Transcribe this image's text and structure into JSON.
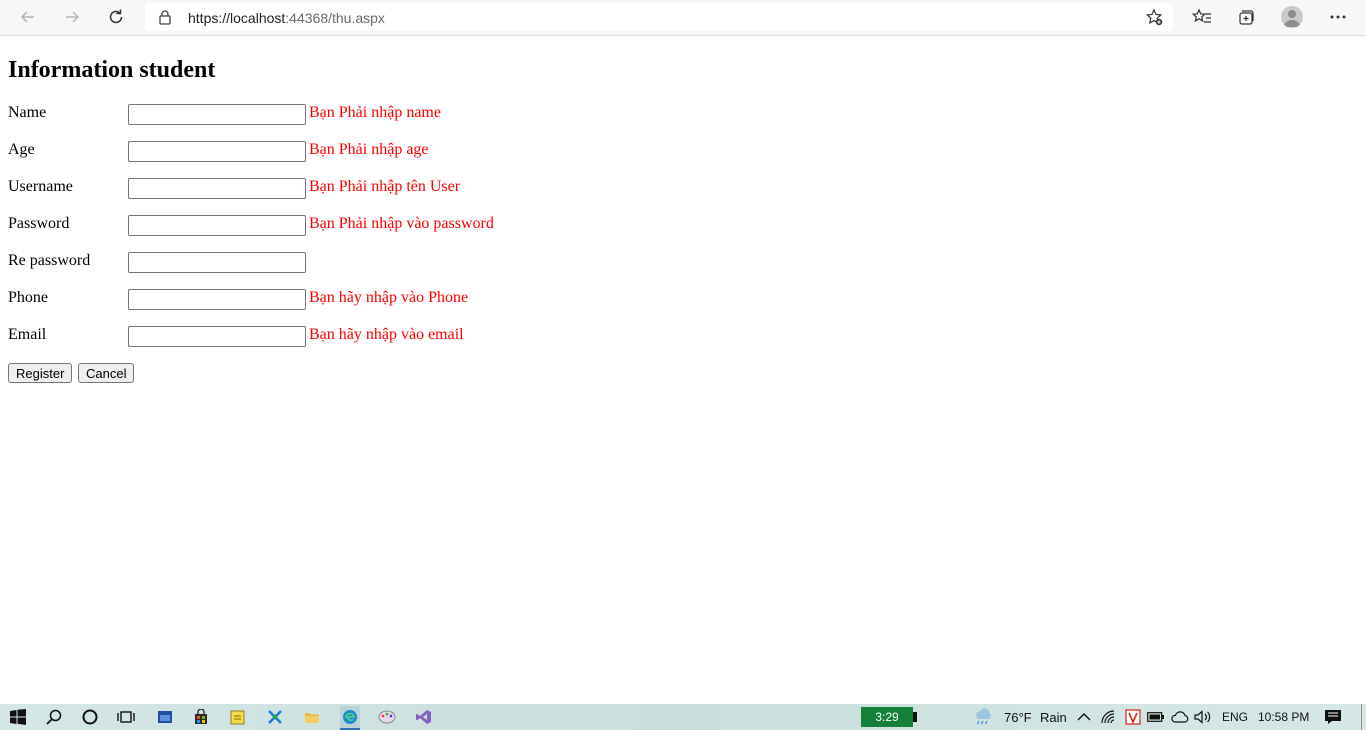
{
  "browser": {
    "url_host": "https://localhost",
    "url_rest": ":44368/thu.aspx"
  },
  "page": {
    "title": "Information student",
    "fields": [
      {
        "label": "Name",
        "value": "",
        "error": "Bạn Phải nhập name"
      },
      {
        "label": "Age",
        "value": "",
        "error": "Bạn Phải nhập age"
      },
      {
        "label": "Username",
        "value": "",
        "error": "Bạn Phải nhập tên User"
      },
      {
        "label": "Password",
        "value": "",
        "error": "Bạn Phải nhập vào password"
      },
      {
        "label": "Re password",
        "value": "",
        "error": ""
      },
      {
        "label": "Phone",
        "value": "",
        "error": "Bạn hãy nhập vào Phone"
      },
      {
        "label": "Email",
        "value": "",
        "error": "Bạn hãy nhập vào email"
      }
    ],
    "register_label": "Register",
    "cancel_label": "Cancel"
  },
  "taskbar": {
    "battery_time": "3:29",
    "weather_temp": "76°F",
    "weather_text": "Rain",
    "language": "ENG",
    "clock": "10:58 PM"
  },
  "colors": {
    "error": "#ff0000",
    "battery": "#16803a"
  }
}
